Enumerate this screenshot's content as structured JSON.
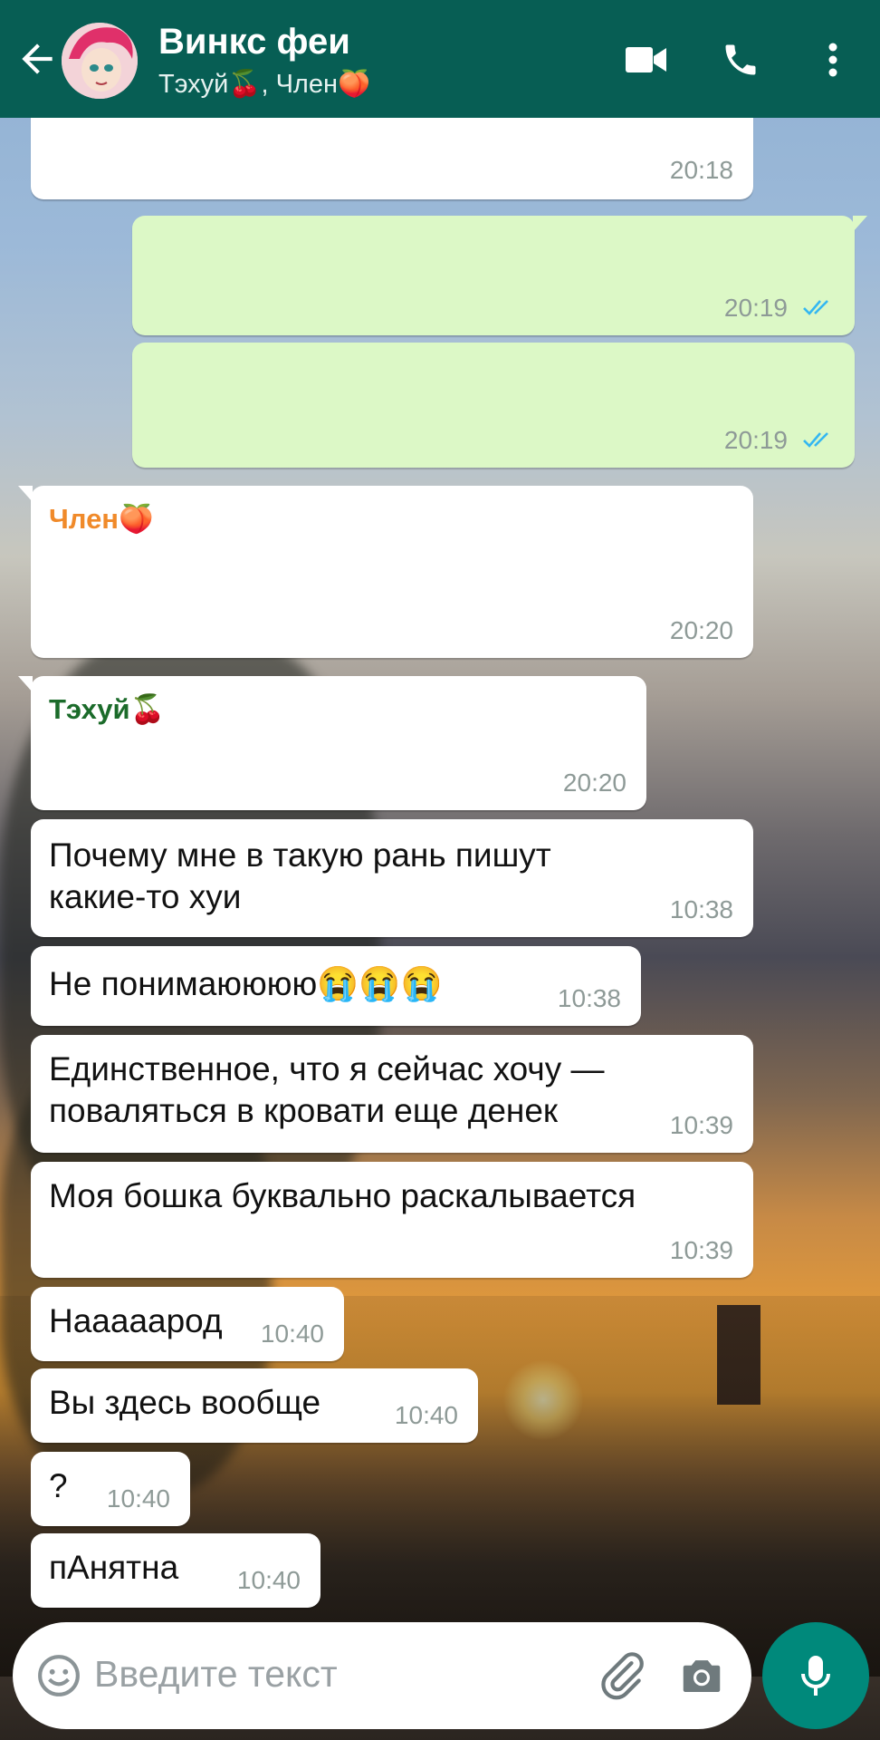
{
  "header": {
    "title": "Винкс феи",
    "subtitle": "Тэхуй🍒, Член🍑"
  },
  "messages": [
    {
      "type": "in",
      "text": "",
      "time": "20:18"
    },
    {
      "type": "out",
      "text": "",
      "time": "20:19"
    },
    {
      "type": "out",
      "text": "",
      "time": "20:19"
    },
    {
      "type": "in",
      "sender": "Член🍑",
      "text": "",
      "time": "20:20"
    },
    {
      "type": "in",
      "sender": "Тэхуй🍒",
      "text": "",
      "time": "20:20"
    },
    {
      "type": "in",
      "text_line1": "Почему мне в такую рань пишут",
      "text_line2": "какие-то хуи",
      "time": "10:38"
    },
    {
      "type": "in",
      "text": "Не понимаюююю😭😭😭",
      "time": "10:38"
    },
    {
      "type": "in",
      "text_line1": "Единственное, что я сейчас хочу —",
      "text_line2": "поваляться в кровати еще денек",
      "time": "10:39"
    },
    {
      "type": "in",
      "text": "Моя бошка буквально раскалывается",
      "time": "10:39"
    },
    {
      "type": "in",
      "text": "Нааааaрод",
      "time": "10:40"
    },
    {
      "type": "in",
      "text": "Вы здесь вообще",
      "time": "10:40"
    },
    {
      "type": "in",
      "text": "?",
      "time": "10:40"
    },
    {
      "type": "in",
      "text": "пАнятна",
      "time": "10:40"
    }
  ],
  "input": {
    "placeholder": "Введите текст"
  },
  "colors": {
    "header": "#075e54",
    "outgoing_bubble": "#dcf8c6",
    "incoming_bubble": "#ffffff",
    "sender_chlen": "#f08a2a",
    "sender_tehui": "#1b6b2a",
    "read_ticks": "#34b7f1",
    "mic_button": "#00897b"
  },
  "icons": [
    "back-arrow-icon",
    "video-call-icon",
    "phone-icon",
    "more-vert-icon",
    "emoji-icon",
    "attach-icon",
    "camera-icon",
    "mic-icon",
    "read-ticks-icon"
  ]
}
